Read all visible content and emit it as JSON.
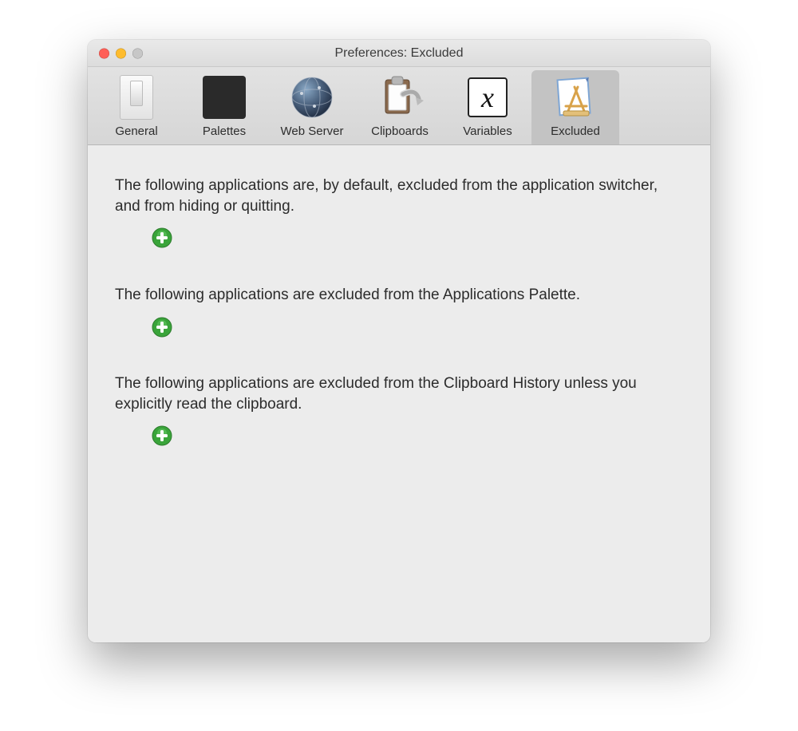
{
  "window": {
    "title": "Preferences: Excluded"
  },
  "toolbar": {
    "tabs": [
      {
        "label": "General"
      },
      {
        "label": "Palettes"
      },
      {
        "label": "Web Server"
      },
      {
        "label": "Clipboards"
      },
      {
        "label": "Variables",
        "glyph": "x"
      },
      {
        "label": "Excluded"
      }
    ]
  },
  "sections": {
    "switcher": {
      "text": "The following applications are, by default, excluded from the application switcher, and from hiding or quitting."
    },
    "palette": {
      "text": "The following applications are excluded from the Applications Palette."
    },
    "clipboard": {
      "text": "The following applications are excluded from the Clipboard History unless you explicitly read the clipboard."
    }
  }
}
